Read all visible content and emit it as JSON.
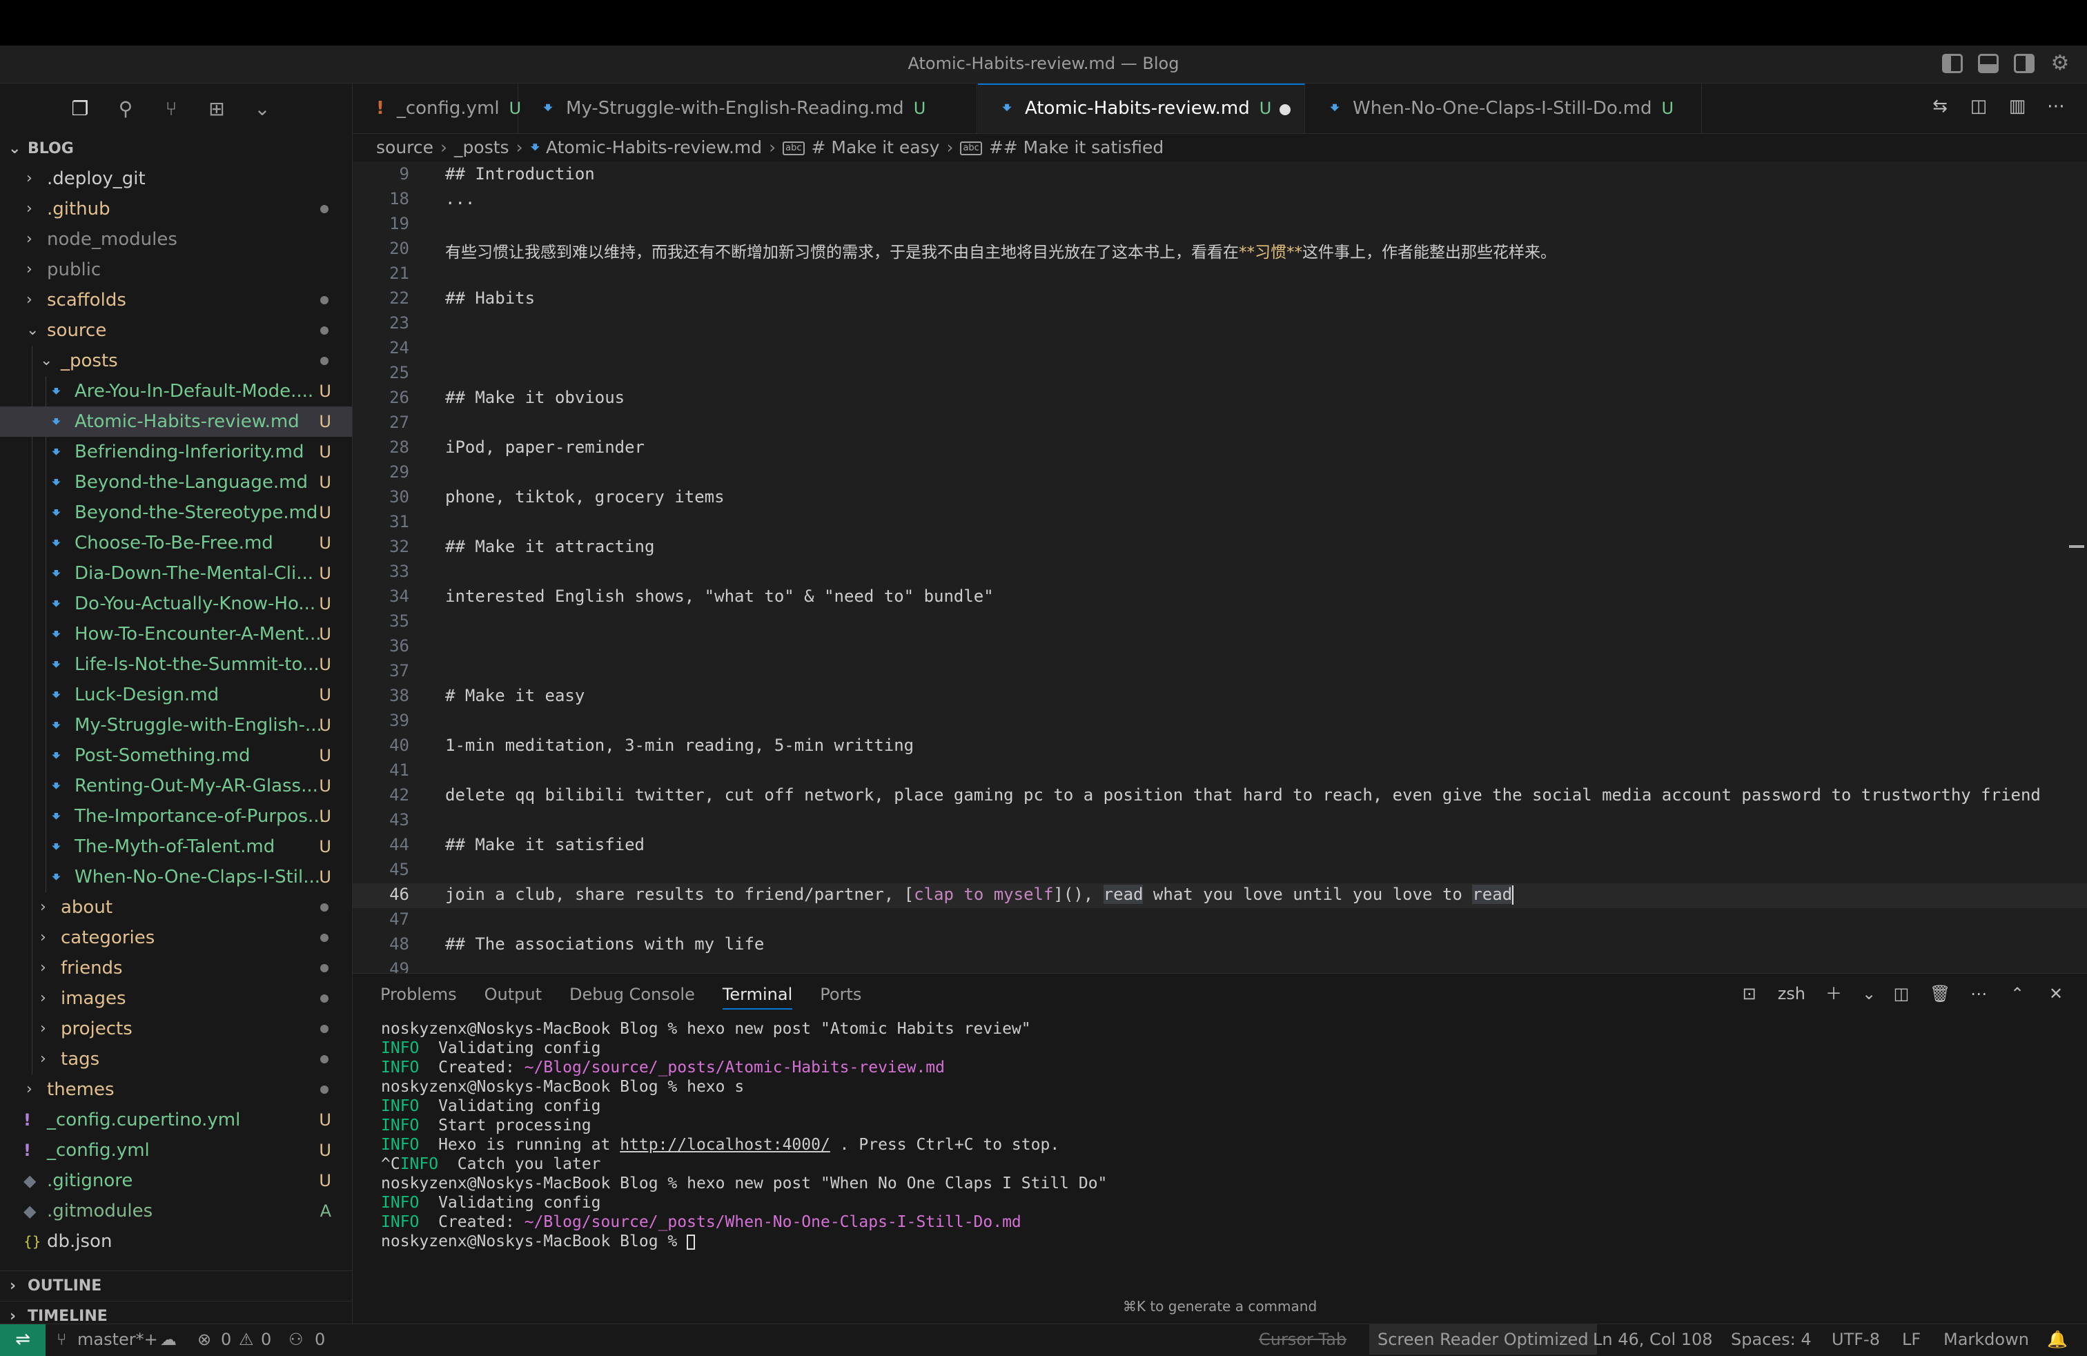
{
  "window": {
    "title": "Atomic-Habits-review.md — Blog"
  },
  "activity": {
    "icons": [
      "files-icon",
      "search-icon",
      "source-control-icon",
      "extensions-icon",
      "chevron-down-icon"
    ]
  },
  "explorer": {
    "root": "BLOG",
    "items": [
      {
        "label": ".deploy_git",
        "type": "folder",
        "state": "normal"
      },
      {
        "label": ".github",
        "type": "folder",
        "state": "normal",
        "dot": true
      },
      {
        "label": "node_modules",
        "type": "folder",
        "state": "dim"
      },
      {
        "label": "public",
        "type": "folder",
        "state": "dim"
      },
      {
        "label": "scaffolds",
        "type": "folder",
        "state": "normal",
        "dot": true
      },
      {
        "label": "source",
        "type": "folder-open",
        "state": "normal",
        "dot": true
      },
      {
        "label": "_posts",
        "type": "folder-open",
        "state": "normal",
        "dot": true
      },
      {
        "label": "Are-You-In-Default-Mode....",
        "badge": "U"
      },
      {
        "label": "Atomic-Habits-review.md",
        "badge": "U",
        "selected": true
      },
      {
        "label": "Befriending-Inferiority.md",
        "badge": "U"
      },
      {
        "label": "Beyond-the-Language.md",
        "badge": "U"
      },
      {
        "label": "Beyond-the-Stereotype.md",
        "badge": "U"
      },
      {
        "label": "Choose-To-Be-Free.md",
        "badge": "U"
      },
      {
        "label": "Dia-Down-The-Mental-Cli...",
        "badge": "U"
      },
      {
        "label": "Do-You-Actually-Know-Ho...",
        "badge": "U"
      },
      {
        "label": "How-To-Encounter-A-Ment...",
        "badge": "U"
      },
      {
        "label": "Life-Is-Not-the-Summit-to...",
        "badge": "U"
      },
      {
        "label": "Luck-Design.md",
        "badge": "U"
      },
      {
        "label": "My-Struggle-with-English-...",
        "badge": "U"
      },
      {
        "label": "Post-Something.md",
        "badge": "U"
      },
      {
        "label": "Renting-Out-My-AR-Glass...",
        "badge": "U"
      },
      {
        "label": "The-Importance-of-Purpos...",
        "badge": "U"
      },
      {
        "label": "The-Myth-of-Talent.md",
        "badge": "U"
      },
      {
        "label": "When-No-One-Claps-I-Stil...",
        "badge": "U"
      },
      {
        "label": "about",
        "type": "folder",
        "dot": true
      },
      {
        "label": "categories",
        "type": "folder",
        "dot": true
      },
      {
        "label": "friends",
        "type": "folder",
        "dot": true
      },
      {
        "label": "images",
        "type": "folder",
        "dot": true
      },
      {
        "label": "projects",
        "type": "folder",
        "dot": true
      },
      {
        "label": "tags",
        "type": "folder",
        "dot": true
      },
      {
        "label": "themes",
        "type": "folder",
        "dot": true
      },
      {
        "label": "_config.cupertino.yml",
        "badge": "U"
      },
      {
        "label": "_config.yml",
        "badge": "U"
      },
      {
        "label": ".gitignore",
        "badge": "U"
      },
      {
        "label": ".gitmodules",
        "badge": "A"
      },
      {
        "label": "db.json"
      }
    ],
    "outline": "OUTLINE",
    "timeline": "TIMELINE"
  },
  "tabs": [
    {
      "label": "_config.yml",
      "badge": "U"
    },
    {
      "label": "My-Struggle-with-English-Reading.md",
      "badge": "U"
    },
    {
      "label": "Atomic-Habits-review.md",
      "badge": "U",
      "active": true,
      "dirty": true
    },
    {
      "label": "When-No-One-Claps-I-Still-Do.md",
      "badge": "U"
    }
  ],
  "breadcrumb": [
    "source",
    "_posts",
    "Atomic-Habits-review.md",
    "# Make it easy",
    "## Make it satisfied"
  ],
  "editor": {
    "lines": [
      {
        "n": "9",
        "text": "## Introduction"
      },
      {
        "n": "18",
        "text": "..."
      },
      {
        "n": "19",
        "text": ""
      },
      {
        "n": "20",
        "pre": "有些习惯让我感到难以维持，而我还有不断增加新习惯的需求，于是我不由自主地将目光放在了这本书上，看看在",
        "bold": "**习惯**",
        "post": "这件事上，作者能整出那些花样来。"
      },
      {
        "n": "21",
        "text": ""
      },
      {
        "n": "22",
        "text": "## Habits"
      },
      {
        "n": "23",
        "text": ""
      },
      {
        "n": "24",
        "text": ""
      },
      {
        "n": "25",
        "text": ""
      },
      {
        "n": "26",
        "text": "## Make it obvious"
      },
      {
        "n": "27",
        "text": ""
      },
      {
        "n": "28",
        "text": "iPod, paper-reminder"
      },
      {
        "n": "29",
        "text": ""
      },
      {
        "n": "30",
        "text": "phone, tiktok, grocery items"
      },
      {
        "n": "31",
        "text": ""
      },
      {
        "n": "32",
        "text": "## Make it attracting"
      },
      {
        "n": "33",
        "text": ""
      },
      {
        "n": "34",
        "text": "interested English shows, \"what to\" & \"need to\" bundle\""
      },
      {
        "n": "35",
        "text": ""
      },
      {
        "n": "36",
        "text": ""
      },
      {
        "n": "37",
        "text": ""
      },
      {
        "n": "38",
        "text": "# Make it easy"
      },
      {
        "n": "39",
        "text": ""
      },
      {
        "n": "40",
        "text": "1-min meditation, 3-min reading, 5-min writting"
      },
      {
        "n": "41",
        "text": ""
      },
      {
        "n": "42",
        "text": "delete qq bilibili twitter, cut off network, place gaming pc to a position that hard to reach, even give the social media account password to trustworthy friend"
      },
      {
        "n": "43",
        "text": ""
      },
      {
        "n": "44",
        "text": "## Make it satisfied"
      },
      {
        "n": "45",
        "text": ""
      },
      {
        "n": "46",
        "current": true,
        "p1": "join a club, share results to friend/partner, [",
        "link": "clap to myself",
        "p2": "](), ",
        "w1": "read",
        "p3": " what you love until you love to ",
        "w2": "read"
      },
      {
        "n": "47",
        "text": ""
      },
      {
        "n": "48",
        "text": "## The associations with my life"
      },
      {
        "n": "49",
        "text": ""
      }
    ]
  },
  "panel": {
    "tabs": [
      "Problems",
      "Output",
      "Debug Console",
      "Terminal",
      "Ports"
    ],
    "active": "Terminal",
    "shell": "zsh",
    "terminal": [
      {
        "text": "noskyzenx@Noskys-MacBook Blog % hexo new post \"Atomic Habits review\""
      },
      {
        "info": "INFO",
        "text": "  Validating config"
      },
      {
        "info": "INFO",
        "text": "  Created: ",
        "path": "~/Blog/source/_posts/Atomic-Habits-review.md"
      },
      {
        "text": "noskyzenx@Noskys-MacBook Blog % hexo s"
      },
      {
        "info": "INFO",
        "text": "  Validating config"
      },
      {
        "info": "INFO",
        "text": "  Start processing"
      },
      {
        "info": "INFO",
        "text": "  Hexo is running at ",
        "url": "http://localhost:4000/",
        "post": " . Press Ctrl+C to stop."
      },
      {
        "text": "^C",
        "info": "INFO",
        "post": "  Catch you later"
      },
      {
        "text": "noskyzenx@Noskys-MacBook Blog % hexo new post \"When No One Claps I Still Do\""
      },
      {
        "info": "INFO",
        "text": "  Validating config"
      },
      {
        "info": "INFO",
        "text": "  Created: ",
        "path": "~/Blog/source/_posts/When-No-One-Claps-I-Still-Do.md"
      },
      {
        "text": "noskyzenx@Noskys-MacBook Blog % ",
        "cursor": true
      }
    ],
    "hint": "⌘K to generate a command"
  },
  "status": {
    "branch": "master*+",
    "errors": "0",
    "warnings": "0",
    "ports": "0",
    "cursor_tab": "Cursor Tab",
    "screen_reader": "Screen Reader Optimized",
    "position": "Ln 46, Col 108",
    "spaces": "Spaces: 4",
    "encoding": "UTF-8",
    "eol": "LF",
    "language": "Markdown"
  }
}
